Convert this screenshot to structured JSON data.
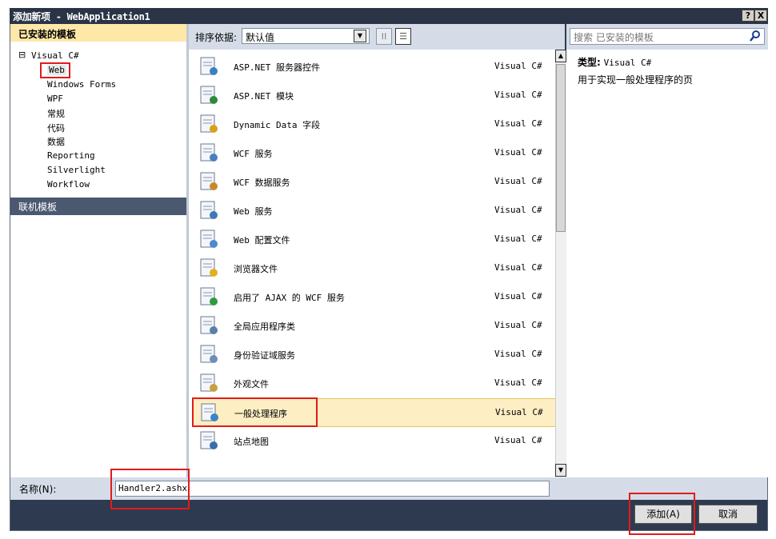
{
  "window": {
    "title": "添加新项 - WebApplication1",
    "help_btn": "?",
    "close_btn": "X"
  },
  "left": {
    "header": "已安装的模板",
    "tree_root": "Visual C#",
    "tree_toggle": "⊟",
    "tree_items": [
      "Web",
      "Windows Forms",
      "WPF",
      "常规",
      "代码",
      "数据",
      "Reporting",
      "Silverlight",
      "Workflow"
    ],
    "online": "联机模板"
  },
  "toolbar": {
    "sort_label": "排序依据:",
    "sort_value": "默认值"
  },
  "items": [
    {
      "name": "ASP.NET 服务器控件",
      "lang": "Visual C#",
      "icon": "server-control-icon"
    },
    {
      "name": "ASP.NET 模块",
      "lang": "Visual C#",
      "icon": "module-icon"
    },
    {
      "name": "Dynamic Data 字段",
      "lang": "Visual C#",
      "icon": "dynamic-data-icon"
    },
    {
      "name": "WCF 服务",
      "lang": "Visual C#",
      "icon": "wcf-service-icon"
    },
    {
      "name": "WCF 数据服务",
      "lang": "Visual C#",
      "icon": "wcf-data-icon"
    },
    {
      "name": "Web 服务",
      "lang": "Visual C#",
      "icon": "web-service-icon"
    },
    {
      "name": "Web 配置文件",
      "lang": "Visual C#",
      "icon": "web-config-icon"
    },
    {
      "name": "浏览器文件",
      "lang": "Visual C#",
      "icon": "browser-file-icon"
    },
    {
      "name": "启用了 AJAX 的 WCF 服务",
      "lang": "Visual C#",
      "icon": "ajax-wcf-icon"
    },
    {
      "name": "全局应用程序类",
      "lang": "Visual C#",
      "icon": "global-app-icon"
    },
    {
      "name": "身份验证域服务",
      "lang": "Visual C#",
      "icon": "auth-domain-icon"
    },
    {
      "name": "外观文件",
      "lang": "Visual C#",
      "icon": "skin-file-icon"
    },
    {
      "name": "一般处理程序",
      "lang": "Visual C#",
      "icon": "generic-handler-icon"
    },
    {
      "name": "站点地图",
      "lang": "Visual C#",
      "icon": "sitemap-icon"
    }
  ],
  "selected_item": "一般处理程序",
  "search": {
    "placeholder": "搜索 已安装的模板"
  },
  "details": {
    "type_label": "类型:",
    "type_value": "Visual C#",
    "description": "用于实现一般处理程序的页"
  },
  "bottom": {
    "name_label": "名称(N):",
    "name_value": "Handler2.ashx",
    "add_button": "添加(A)",
    "cancel_button": "取消"
  },
  "colors": {
    "titlebar": "#2a3446",
    "header_yellow": "#fde8a8",
    "selection": "#fdeec4",
    "panel": "#d5dce8",
    "highlight_red": "#e21b1b"
  }
}
